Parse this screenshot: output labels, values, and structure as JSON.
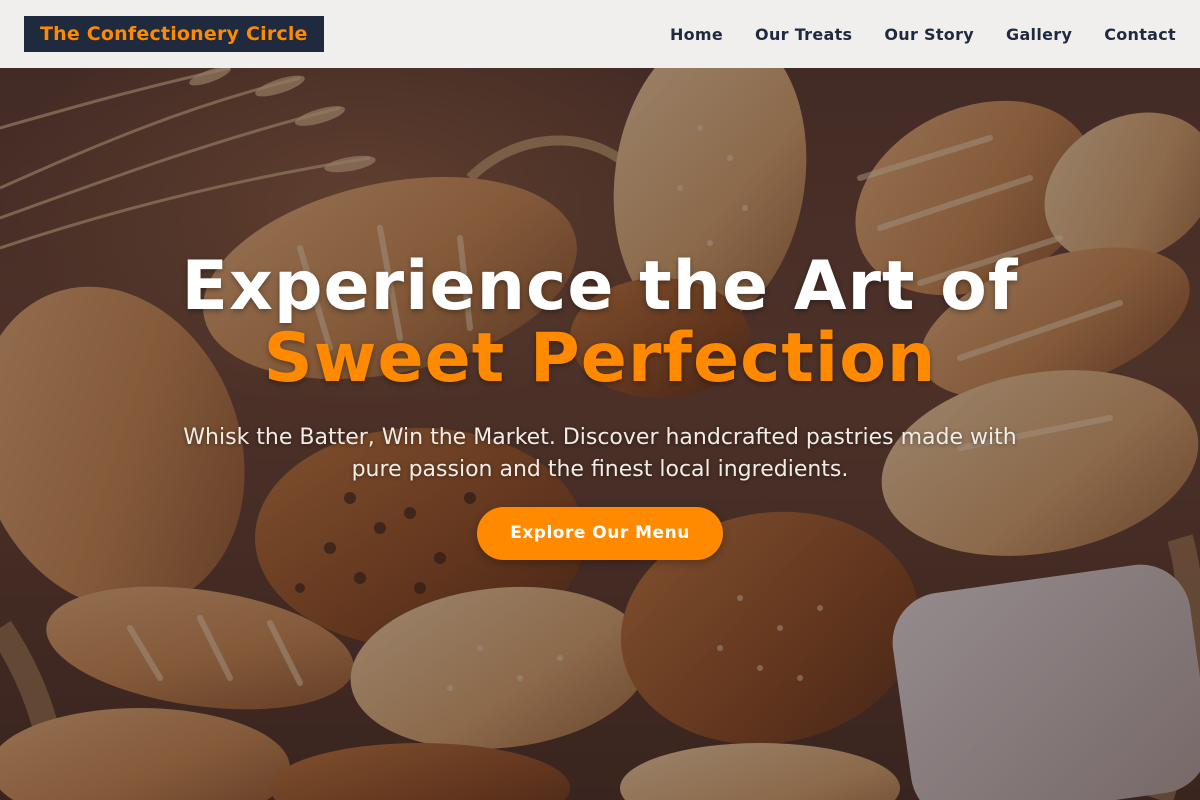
{
  "header": {
    "logo_text": "The Confectionery Circle",
    "nav": [
      {
        "label": "Home"
      },
      {
        "label": "Our Treats"
      },
      {
        "label": "Our Story"
      },
      {
        "label": "Gallery"
      },
      {
        "label": "Contact"
      }
    ]
  },
  "hero": {
    "title_line1": "Experience the Art of",
    "title_line2": "Sweet Perfection",
    "subtitle": "Whisk the Batter, Win the Market. Discover handcrafted pastries made with pure passion and the finest local ingredients.",
    "cta_label": "Explore Our Menu",
    "background_image": "bread-basket-photo"
  },
  "colors": {
    "accent": "#ff8a00",
    "navy": "#1f2a3f",
    "header_bg": "#f1efed"
  }
}
